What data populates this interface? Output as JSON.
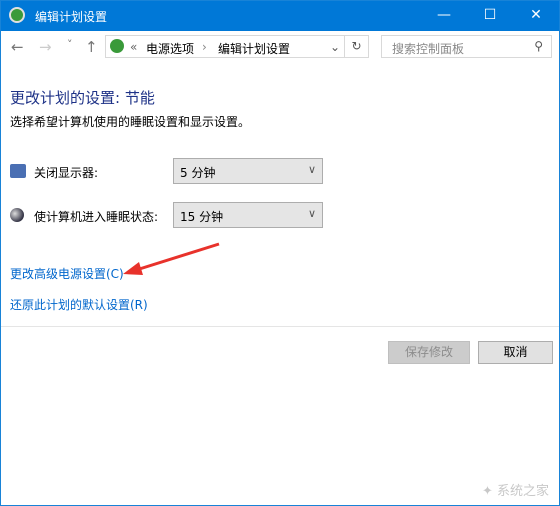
{
  "window": {
    "title": "编辑计划设置",
    "minimize": "—",
    "maximize": "☐",
    "close": "✕"
  },
  "nav": {
    "back": "←",
    "forward": "→",
    "recent": "˅",
    "up": "↑",
    "breadcrumb": [
      "«",
      "电源选项",
      "›",
      "编辑计划设置"
    ],
    "dropdown": "⌄",
    "refresh": "↻",
    "search_placeholder": "搜索控制面板",
    "search_icon": "⚲"
  },
  "main": {
    "title": "更改计划的设置: 节能",
    "subtitle": "选择希望计算机使用的睡眠设置和显示设置。",
    "settings": [
      {
        "label": "关闭显示器:",
        "value": "5 分钟",
        "icon": "monitor-clock-icon"
      },
      {
        "label": "使计算机进入睡眠状态:",
        "value": "15 分钟",
        "icon": "moon-icon"
      }
    ],
    "links": [
      "更改高级电源设置(C)",
      "还原此计划的默认设置(R)"
    ],
    "save": "保存修改",
    "cancel": "取消"
  },
  "annotation_color": "#e8322b",
  "watermark": "系统之家"
}
